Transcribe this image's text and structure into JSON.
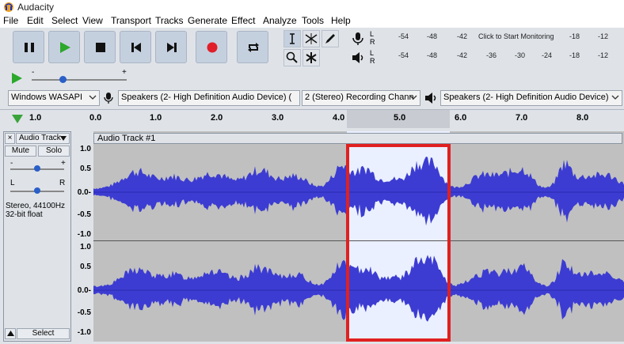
{
  "app": {
    "title": "Audacity"
  },
  "menu": [
    "File",
    "Edit",
    "Select",
    "View",
    "Transport",
    "Tracks",
    "Generate",
    "Effect",
    "Analyze",
    "Tools",
    "Help"
  ],
  "meters": {
    "record_channels": [
      "L",
      "R"
    ],
    "play_channels": [
      "L",
      "R"
    ],
    "record_scale": [
      "-54",
      "-48",
      "-42",
      "Click to Start Monitoring",
      "-18",
      "-12"
    ],
    "play_scale": [
      "-54",
      "-48",
      "-42",
      "-36",
      "-30",
      "-24",
      "-18",
      "-12"
    ]
  },
  "devices": {
    "host": "Windows WASAPI",
    "recording_device": "Speakers (2- High Definition Audio Device) (",
    "channels": "2 (Stereo) Recording Chann",
    "playback_device": "Speakers (2- High Definition Audio Device)"
  },
  "play_speed": {
    "minus": "-",
    "plus": "+"
  },
  "ruler": {
    "labels": [
      "1.0",
      "0.0",
      "1.0",
      "2.0",
      "3.0",
      "4.0",
      "5.0",
      "6.0",
      "7.0",
      "8.0"
    ]
  },
  "track": {
    "name_menu": "Audio Track",
    "close": "×",
    "mute": "Mute",
    "solo": "Solo",
    "gain_minus": "-",
    "gain_plus": "+",
    "pan_left": "L",
    "pan_right": "R",
    "info_line1": "Stereo, 44100Hz",
    "info_line2": "32-bit float",
    "select": "Select",
    "clip_name": "Audio Track #1",
    "scale_labels": [
      "1.0",
      "0.5",
      "0.0-",
      "-0.5",
      "-1.0"
    ]
  },
  "colors": {
    "wave": "#3c3cd2",
    "selection": "#ffffff",
    "highlight": "#e02020",
    "button": "#c5d0df"
  }
}
